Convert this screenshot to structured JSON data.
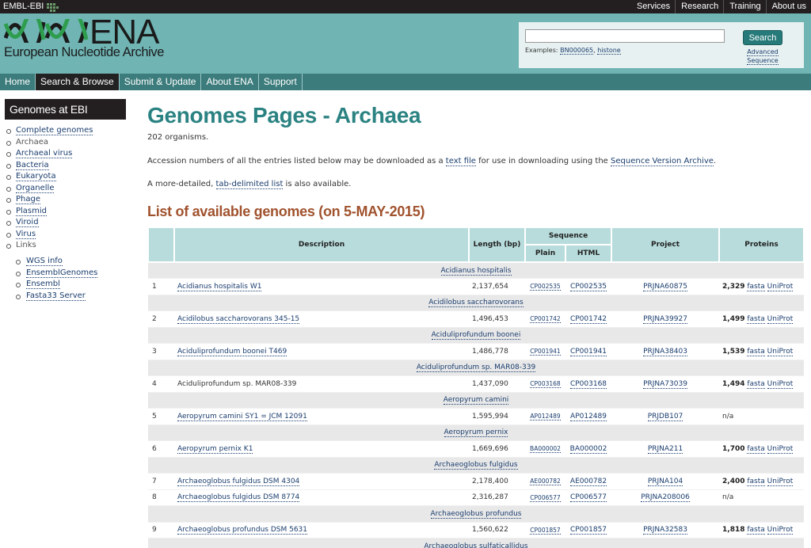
{
  "topbar": {
    "brand": "EMBL-EBI",
    "nav": [
      "Services",
      "Research",
      "Training",
      "About us"
    ]
  },
  "header": {
    "logo_text": "ENA",
    "logo_subtitle": "European Nucleotide Archive",
    "search": {
      "input_value": "",
      "button_label": "Search",
      "examples_label": "Examples:",
      "example_1": "BN000065",
      "example_sep": ",",
      "example_2": "histone",
      "advanced_line1": "Advanced",
      "advanced_line2": "Sequence"
    }
  },
  "mainnav": {
    "items": [
      {
        "label": "Home"
      },
      {
        "label": "Search & Browse"
      },
      {
        "label": "Submit & Update"
      },
      {
        "label": "About ENA"
      },
      {
        "label": "Support"
      }
    ]
  },
  "sidebar": {
    "heading": "Genomes at EBI",
    "items": [
      {
        "label": "Complete genomes"
      },
      {
        "label": "Archaea"
      },
      {
        "label": "Archaeal virus"
      },
      {
        "label": "Bacteria"
      },
      {
        "label": "Eukaryota"
      },
      {
        "label": "Organelle"
      },
      {
        "label": "Phage"
      },
      {
        "label": "Plasmid"
      },
      {
        "label": "Viroid"
      },
      {
        "label": "Virus"
      },
      {
        "label": "Links"
      }
    ],
    "links": [
      {
        "label": "WGS info"
      },
      {
        "label": "EnsemblGenomes"
      },
      {
        "label": "Ensembl"
      },
      {
        "label": "Fasta33 Server"
      }
    ]
  },
  "main": {
    "title": "Genomes Pages - Archaea",
    "organisms": "202 organisms.",
    "p2_before": "Accession numbers of all the entries listed below may be downloaded as a ",
    "p2_link1": "text file",
    "p2_middle": " for use in downloading using the ",
    "p2_link2": "Sequence Version Archive",
    "p2_after": ".",
    "p3_before": "A more-detailed, ",
    "p3_link": "tab-delimited list",
    "p3_after": " is also available.",
    "list_title": "List of available genomes (on 5-MAY-2015)"
  },
  "table": {
    "headers": {
      "description": "Description",
      "length": "Length (bp)",
      "sequence": "Sequence",
      "plain": "Plain",
      "html": "HTML",
      "project": "Project",
      "proteins": "Proteins"
    },
    "rows": [
      {
        "type": "group",
        "label": "Acidianus hospitalis"
      },
      {
        "type": "entry",
        "num": "1",
        "desc": "Acidianus hospitalis W1",
        "length": "2,137,654",
        "plain": "CP002535",
        "html": "CP002535",
        "project": "PRJNA60875",
        "proteins": "2,329",
        "fasta": "fasta",
        "uniprot": "UniProt"
      },
      {
        "type": "group",
        "label": "Acidilobus saccharovorans"
      },
      {
        "type": "entry",
        "num": "2",
        "desc": "Acidilobus saccharovorans 345-15",
        "length": "1,496,453",
        "plain": "CP001742",
        "html": "CP001742",
        "project": "PRJNA39927",
        "proteins": "1,499",
        "fasta": "fasta",
        "uniprot": "UniProt"
      },
      {
        "type": "group",
        "label": "Aciduliprofundum boonei"
      },
      {
        "type": "entry",
        "num": "3",
        "desc": "Aciduliprofundum boonei T469",
        "length": "1,486,778",
        "plain": "CP001941",
        "html": "CP001941",
        "project": "PRJNA38403",
        "proteins": "1,539",
        "fasta": "fasta",
        "uniprot": "UniProt"
      },
      {
        "type": "group",
        "label": "Aciduliprofundum sp. MAR08-339"
      },
      {
        "type": "entry",
        "num": "4",
        "desc": "Aciduliprofundum sp. MAR08-339",
        "desc_plain": true,
        "length": "1,437,090",
        "plain": "CP003168",
        "html": "CP003168",
        "project": "PRJNA73039",
        "proteins": "1,494",
        "fasta": "fasta",
        "uniprot": "UniProt"
      },
      {
        "type": "group",
        "label": "Aeropyrum camini"
      },
      {
        "type": "entry",
        "num": "5",
        "desc": "Aeropyrum camini SY1 = JCM 12091",
        "length": "1,595,994",
        "plain": "AP012489",
        "html": "AP012489",
        "project": "PRJDB107",
        "proteins_na": "n/a"
      },
      {
        "type": "group",
        "label": "Aeropyrum pernix"
      },
      {
        "type": "entry",
        "num": "6",
        "desc": "Aeropyrum pernix K1",
        "length": "1,669,696",
        "plain": "BA000002",
        "html": "BA000002",
        "project": "PRJNA211",
        "proteins": "1,700",
        "fasta": "fasta",
        "uniprot": "UniProt"
      },
      {
        "type": "group",
        "label": "Archaeoglobus fulgidus"
      },
      {
        "type": "entry",
        "num": "7",
        "desc": "Archaeoglobus fulgidus DSM 4304",
        "length": "2,178,400",
        "plain": "AE000782",
        "html": "AE000782",
        "project": "PRJNA104",
        "proteins": "2,400",
        "fasta": "fasta",
        "uniprot": "UniProt"
      },
      {
        "type": "entry",
        "num": "8",
        "desc": "Archaeoglobus fulgidus DSM 8774",
        "length": "2,316,287",
        "plain": "CP006577",
        "html": "CP006577",
        "project": "PRJNA208006",
        "proteins_na": "n/a"
      },
      {
        "type": "group",
        "label": "Archaeoglobus profundus"
      },
      {
        "type": "entry",
        "num": "9",
        "desc": "Archaeoglobus profundus DSM 5631",
        "length": "1,560,622",
        "plain": "CP001857",
        "html": "CP001857",
        "project": "PRJNA32583",
        "proteins": "1,818",
        "fasta": "fasta",
        "uniprot": "UniProt"
      },
      {
        "type": "group",
        "label": "Archaeoglobus sulfaticallidus"
      }
    ]
  }
}
